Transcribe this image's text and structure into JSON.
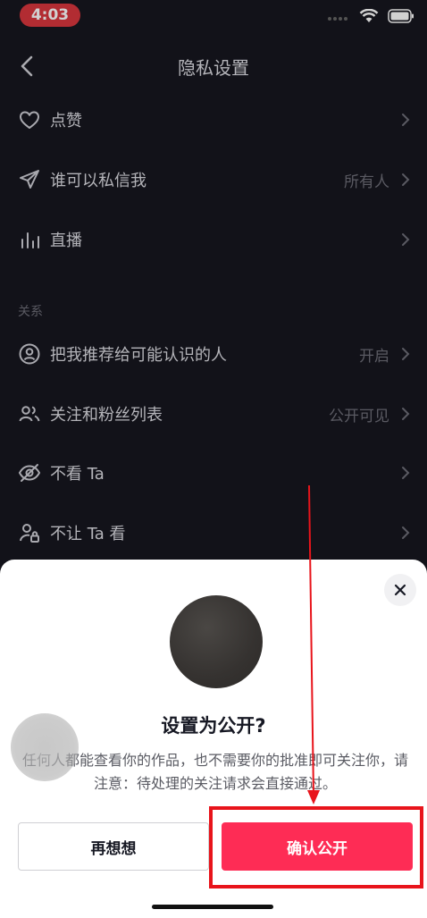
{
  "status": {
    "time": "4:03"
  },
  "nav": {
    "title": "隐私设置"
  },
  "rows": [
    {
      "label": "点赞",
      "value": ""
    },
    {
      "label": "谁可以私信我",
      "value": "所有人"
    },
    {
      "label": "直播",
      "value": ""
    },
    {
      "label": "把我推荐给可能认识的人",
      "value": "开启"
    },
    {
      "label": "关注和粉丝列表",
      "value": "公开可见"
    },
    {
      "label": "不看 Ta",
      "value": ""
    },
    {
      "label": "不让 Ta 看",
      "value": ""
    }
  ],
  "section": {
    "relations": "关系"
  },
  "dialog": {
    "title": "设置为公开?",
    "description": "任何人都能查看你的作品，也不需要你的批准即可关注你，请注意：待处理的关注请求会直接通过。",
    "cancel_label": "再想想",
    "confirm_label": "确认公开"
  },
  "colors": {
    "accent": "#fe2c55",
    "annotation": "#e8141b",
    "background": "#16161f"
  }
}
